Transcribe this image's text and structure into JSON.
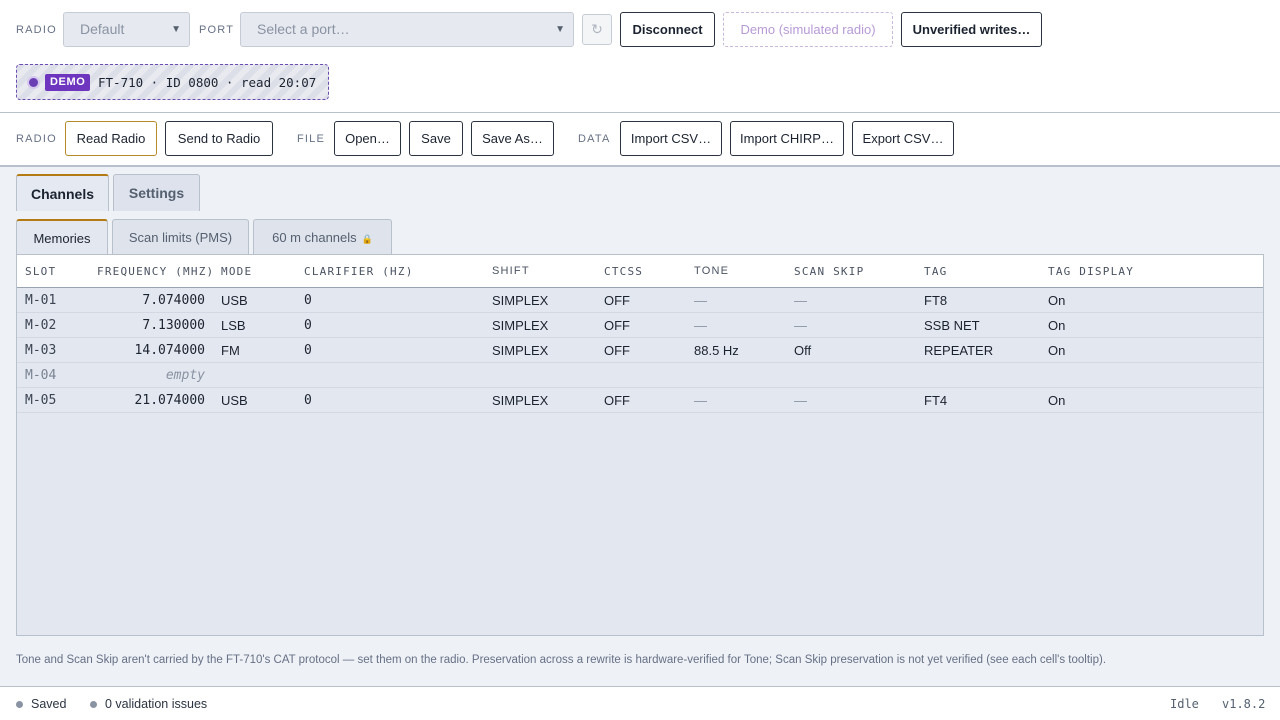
{
  "connection": {
    "radio_label": "RADIO",
    "radio_select_value": "Default",
    "port_label": "PORT",
    "port_placeholder": "Select a port…",
    "refresh_icon": "↻",
    "disconnect_label": "Disconnect",
    "demo_label": "Demo (simulated radio)",
    "unverified_label": "Unverified writes…"
  },
  "status_chip": {
    "badge": "DEMO",
    "text": "FT-710 · ID 0800 · read 20:07",
    "accent_color": "#6e35bf"
  },
  "toolbar": {
    "radio_group_label": "RADIO",
    "read_radio": "Read Radio",
    "send_to_radio": "Send to Radio",
    "file_group_label": "FILE",
    "open": "Open…",
    "save": "Save",
    "save_as": "Save As…",
    "data_group_label": "DATA",
    "import_csv": "Import CSV…",
    "import_chirp": "Import CHIRP…",
    "export_csv": "Export CSV…"
  },
  "tabs": [
    {
      "label": "Channels",
      "active": true
    },
    {
      "label": "Settings",
      "active": false
    }
  ],
  "subtabs": [
    {
      "label": "Memories",
      "active": true
    },
    {
      "label": "Scan limits (PMS)",
      "active": false
    },
    {
      "label": "60 m channels",
      "active": false,
      "icon": "lock-icon"
    }
  ],
  "table": {
    "columns": [
      "SLOT",
      "FREQUENCY (MHZ)",
      "MODE",
      "CLARIFIER (HZ)",
      "SHIFT",
      "CTCSS",
      "TONE",
      "SCAN SKIP",
      "TAG",
      "TAG DISPLAY"
    ],
    "rows": [
      {
        "slot": "M-01",
        "freq": "7.074000",
        "mode": "USB",
        "clarifier": "0",
        "shift": "SIMPLEX",
        "ctcss": "OFF",
        "tone": "—",
        "scan_skip": "—",
        "tag": "FT8",
        "tag_display": "On"
      },
      {
        "slot": "M-02",
        "freq": "7.130000",
        "mode": "LSB",
        "clarifier": "0",
        "shift": "SIMPLEX",
        "ctcss": "OFF",
        "tone": "—",
        "scan_skip": "—",
        "tag": "SSB NET",
        "tag_display": "On"
      },
      {
        "slot": "M-03",
        "freq": "14.074000",
        "mode": "FM",
        "clarifier": "0",
        "shift": "SIMPLEX",
        "ctcss": "OFF",
        "tone": "88.5 Hz",
        "scan_skip": "Off",
        "tag": "REPEATER",
        "tag_display": "On"
      },
      {
        "slot": "M-04",
        "freq": "empty",
        "mode": "",
        "clarifier": "",
        "shift": "",
        "ctcss": "",
        "tone": "",
        "scan_skip": "",
        "tag": "",
        "tag_display": ""
      },
      {
        "slot": "M-05",
        "freq": "21.074000",
        "mode": "USB",
        "clarifier": "0",
        "shift": "SIMPLEX",
        "ctcss": "OFF",
        "tone": "—",
        "scan_skip": "—",
        "tag": "FT4",
        "tag_display": "On"
      }
    ]
  },
  "footnote": "Tone and Scan Skip aren't carried by the FT-710's CAT protocol — set them on the radio. Preservation across a rewrite is hardware-verified for Tone; Scan Skip preservation is not yet verified (see each cell's tooltip).",
  "status_bar": {
    "saved": "Saved",
    "validation": "0 validation issues",
    "state": "Idle",
    "version": "v1.8.2"
  }
}
